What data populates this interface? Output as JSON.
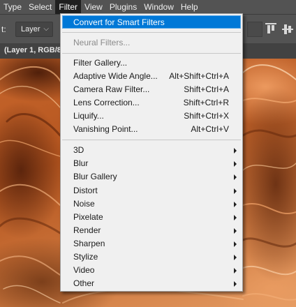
{
  "menubar": {
    "items": [
      {
        "label": "Type"
      },
      {
        "label": "Select"
      },
      {
        "label": "Filter"
      },
      {
        "label": "View"
      },
      {
        "label": "Plugins"
      },
      {
        "label": "Window"
      },
      {
        "label": "Help"
      }
    ]
  },
  "options": {
    "label_fragment": "t:",
    "layer_select": "Layer"
  },
  "document": {
    "tab_title": "(Layer 1, RGB/8"
  },
  "filter_menu": {
    "convert": "Convert for Smart Filters",
    "neural": "Neural Filters...",
    "group1": [
      {
        "label": "Filter Gallery...",
        "shortcut": ""
      },
      {
        "label": "Adaptive Wide Angle...",
        "shortcut": "Alt+Shift+Ctrl+A"
      },
      {
        "label": "Camera Raw Filter...",
        "shortcut": "Shift+Ctrl+A"
      },
      {
        "label": "Lens Correction...",
        "shortcut": "Shift+Ctrl+R"
      },
      {
        "label": "Liquify...",
        "shortcut": "Shift+Ctrl+X"
      },
      {
        "label": "Vanishing Point...",
        "shortcut": "Alt+Ctrl+V"
      }
    ],
    "submenus": [
      {
        "label": "3D"
      },
      {
        "label": "Blur"
      },
      {
        "label": "Blur Gallery"
      },
      {
        "label": "Distort"
      },
      {
        "label": "Noise"
      },
      {
        "label": "Pixelate"
      },
      {
        "label": "Render"
      },
      {
        "label": "Sharpen"
      },
      {
        "label": "Stylize"
      },
      {
        "label": "Video"
      },
      {
        "label": "Other"
      }
    ]
  },
  "colors": {
    "highlight": "#0078d7",
    "menubar": "#535353",
    "menu_bg": "#f0f0f0"
  }
}
